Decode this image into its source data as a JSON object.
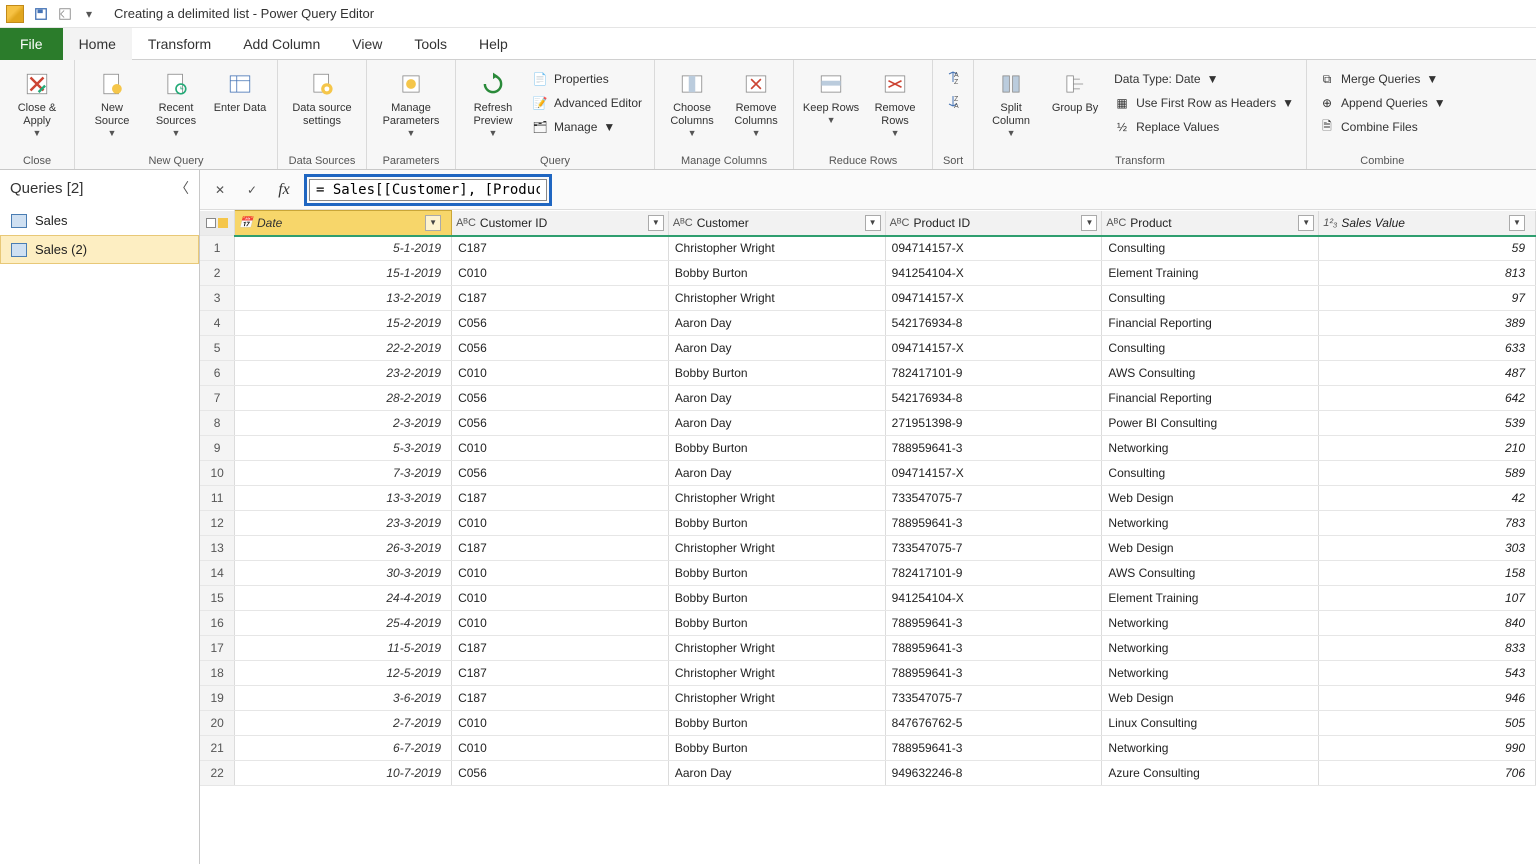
{
  "title": "Creating a delimited list - Power Query Editor",
  "menu": {
    "file": "File",
    "home": "Home",
    "transform": "Transform",
    "add": "Add Column",
    "view": "View",
    "tools": "Tools",
    "help": "Help"
  },
  "ribbon": {
    "close_apply": "Close &\nApply",
    "new_source": "New\nSource",
    "recent_sources": "Recent\nSources",
    "enter_data": "Enter\nData",
    "ds_settings": "Data source\nsettings",
    "manage_params": "Manage\nParameters",
    "refresh": "Refresh\nPreview",
    "properties": "Properties",
    "adv_editor": "Advanced Editor",
    "manage": "Manage",
    "choose_cols": "Choose\nColumns",
    "remove_cols": "Remove\nColumns",
    "keep_rows": "Keep\nRows",
    "remove_rows": "Remove\nRows",
    "split_col": "Split\nColumn",
    "group_by": "Group\nBy",
    "data_type": "Data Type: Date",
    "first_row": "Use First Row as Headers",
    "replace": "Replace Values",
    "merge": "Merge Queries",
    "append": "Append Queries",
    "combine_files": "Combine Files",
    "g_close": "Close",
    "g_newq": "New Query",
    "g_ds": "Data Sources",
    "g_params": "Parameters",
    "g_query": "Query",
    "g_mc": "Manage Columns",
    "g_rr": "Reduce Rows",
    "g_sort": "Sort",
    "g_transform": "Transform",
    "g_combine": "Combine"
  },
  "queries_header": "Queries [2]",
  "queries": [
    {
      "name": "Sales"
    },
    {
      "name": "Sales (2)"
    }
  ],
  "formula": "= Sales[[Customer], [Product]]",
  "columns": [
    "Date",
    "Customer ID",
    "Customer",
    "Product ID",
    "Product",
    "Sales Value"
  ],
  "coltypes": [
    "📅",
    "AᴮC",
    "AᴮC",
    "AᴮC",
    "AᴮC",
    "1²₃"
  ],
  "rows": [
    [
      "5-1-2019",
      "C187",
      "Christopher Wright",
      "094714157-X",
      "Consulting",
      "59"
    ],
    [
      "15-1-2019",
      "C010",
      "Bobby Burton",
      "941254104-X",
      "Element Training",
      "813"
    ],
    [
      "13-2-2019",
      "C187",
      "Christopher Wright",
      "094714157-X",
      "Consulting",
      "97"
    ],
    [
      "15-2-2019",
      "C056",
      "Aaron Day",
      "542176934-8",
      "Financial Reporting",
      "389"
    ],
    [
      "22-2-2019",
      "C056",
      "Aaron Day",
      "094714157-X",
      "Consulting",
      "633"
    ],
    [
      "23-2-2019",
      "C010",
      "Bobby Burton",
      "782417101-9",
      "AWS Consulting",
      "487"
    ],
    [
      "28-2-2019",
      "C056",
      "Aaron Day",
      "542176934-8",
      "Financial Reporting",
      "642"
    ],
    [
      "2-3-2019",
      "C056",
      "Aaron Day",
      "271951398-9",
      "Power BI Consulting",
      "539"
    ],
    [
      "5-3-2019",
      "C010",
      "Bobby Burton",
      "788959641-3",
      "Networking",
      "210"
    ],
    [
      "7-3-2019",
      "C056",
      "Aaron Day",
      "094714157-X",
      "Consulting",
      "589"
    ],
    [
      "13-3-2019",
      "C187",
      "Christopher Wright",
      "733547075-7",
      "Web Design",
      "42"
    ],
    [
      "23-3-2019",
      "C010",
      "Bobby Burton",
      "788959641-3",
      "Networking",
      "783"
    ],
    [
      "26-3-2019",
      "C187",
      "Christopher Wright",
      "733547075-7",
      "Web Design",
      "303"
    ],
    [
      "30-3-2019",
      "C010",
      "Bobby Burton",
      "782417101-9",
      "AWS Consulting",
      "158"
    ],
    [
      "24-4-2019",
      "C010",
      "Bobby Burton",
      "941254104-X",
      "Element Training",
      "107"
    ],
    [
      "25-4-2019",
      "C010",
      "Bobby Burton",
      "788959641-3",
      "Networking",
      "840"
    ],
    [
      "11-5-2019",
      "C187",
      "Christopher Wright",
      "788959641-3",
      "Networking",
      "833"
    ],
    [
      "12-5-2019",
      "C187",
      "Christopher Wright",
      "788959641-3",
      "Networking",
      "543"
    ],
    [
      "3-6-2019",
      "C187",
      "Christopher Wright",
      "733547075-7",
      "Web Design",
      "946"
    ],
    [
      "2-7-2019",
      "C010",
      "Bobby Burton",
      "847676762-5",
      "Linux Consulting",
      "505"
    ],
    [
      "6-7-2019",
      "C010",
      "Bobby Burton",
      "788959641-3",
      "Networking",
      "990"
    ],
    [
      "10-7-2019",
      "C056",
      "Aaron Day",
      "949632246-8",
      "Azure Consulting",
      "706"
    ]
  ]
}
